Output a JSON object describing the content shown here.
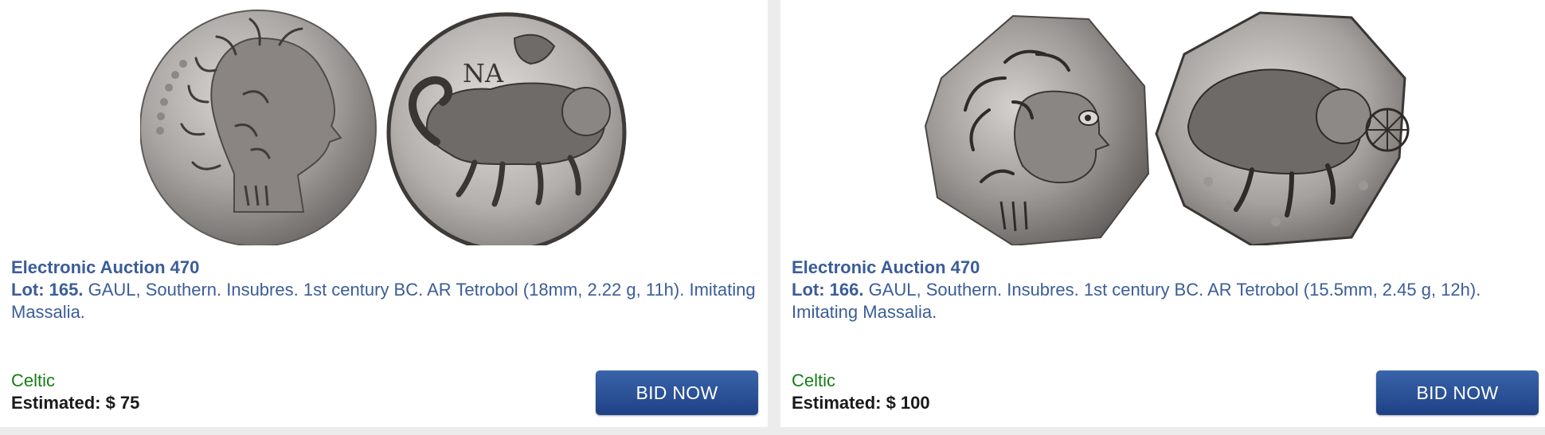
{
  "lots": [
    {
      "auction_title": "Electronic Auction 470",
      "lot_label": "Lot: 165.",
      "description": " GAUL, Southern. Insubres. 1st century BC. AR Tetrobol (18mm, 2.22 g, 11h). Imitating Massalia.",
      "category": "Celtic",
      "estimate": "Estimated: $ 75",
      "bid_label": "BID NOW",
      "obverse_legend": "",
      "reverse_legend": "ΝΑ"
    },
    {
      "auction_title": "Electronic Auction 470",
      "lot_label": "Lot: 166.",
      "description": " GAUL, Southern. Insubres. 1st century BC. AR Tetrobol (15.5mm, 2.45 g, 12h). Imitating Massalia.",
      "category": "Celtic",
      "estimate": "Estimated: $ 100",
      "bid_label": "BID NOW",
      "obverse_legend": "",
      "reverse_legend": ""
    }
  ],
  "colors": {
    "title_blue": "#3b5d98",
    "category_green": "#167d16",
    "button_blue": "#2a4f96",
    "background": "#ececec"
  }
}
